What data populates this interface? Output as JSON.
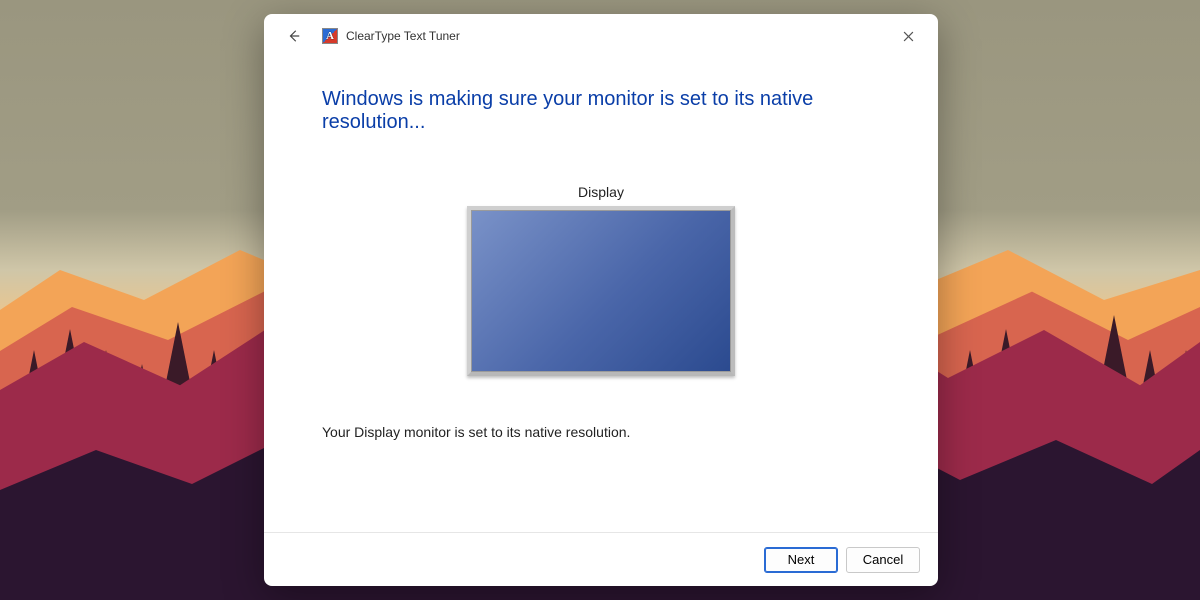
{
  "window": {
    "title": "ClearType Text Tuner"
  },
  "page": {
    "heading": "Windows is making sure your monitor is set to its native resolution...",
    "display_label": "Display",
    "status": "Your Display monitor is set to its native resolution."
  },
  "footer": {
    "next": "Next",
    "cancel": "Cancel"
  },
  "icons": {
    "back": "←",
    "close": "✕"
  }
}
